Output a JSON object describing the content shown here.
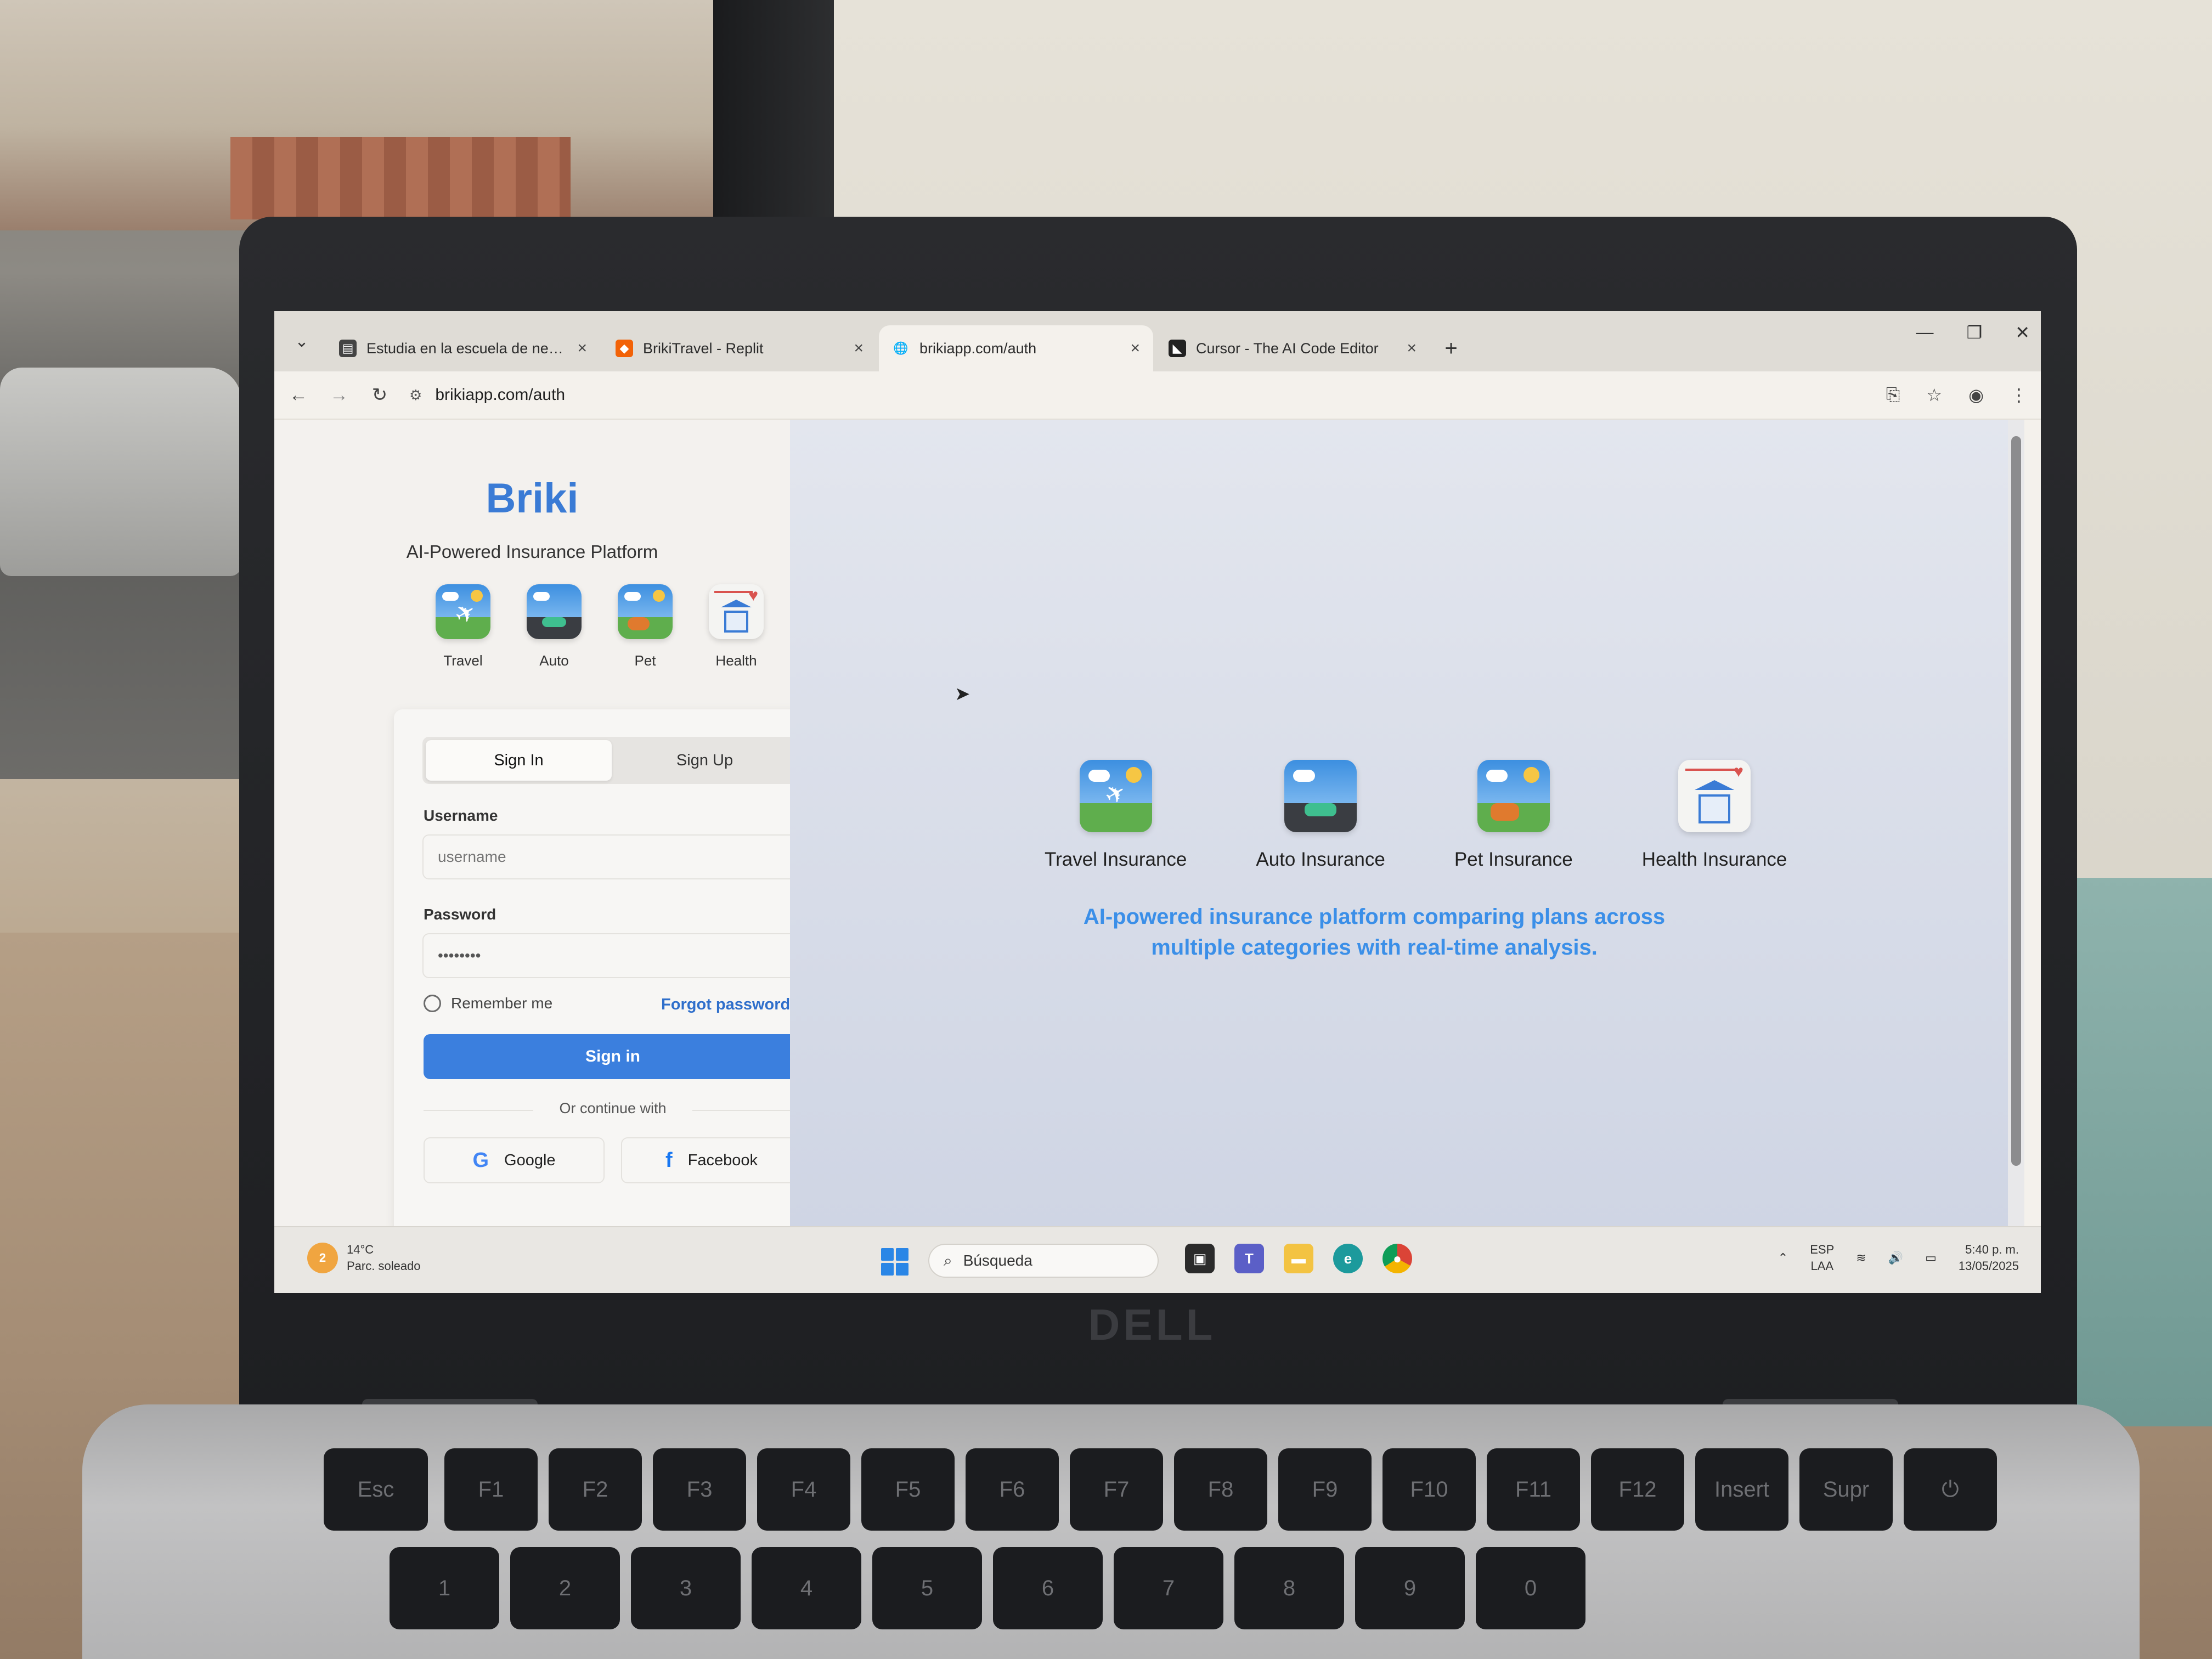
{
  "browser": {
    "tabs": [
      {
        "title": "Estudia en la escuela de negocios",
        "favicon": "page-icon"
      },
      {
        "title": "BrikiTravel - Replit",
        "favicon": "replit-icon"
      },
      {
        "title": "brikiapp.com/auth",
        "favicon": "globe-icon",
        "active": true
      },
      {
        "title": "Cursor - The AI Code Editor",
        "favicon": "cursor-icon"
      }
    ],
    "url": "brikiapp.com/auth"
  },
  "app": {
    "brand": "Briki",
    "tagline": "AI-Powered Insurance Platform",
    "mini_categories": [
      "Travel",
      "Auto",
      "Pet",
      "Health"
    ],
    "auth": {
      "tabs": [
        "Sign In",
        "Sign Up"
      ],
      "username_label": "Username",
      "username_placeholder": "username",
      "password_label": "Password",
      "password_value": "••••••••",
      "remember_label": "Remember me",
      "forgot_label": "Forgot password?",
      "submit_label": "Sign in",
      "divider_label": "Or continue with",
      "google_label": "Google",
      "facebook_label": "Facebook"
    },
    "hero": {
      "categories": [
        "Travel Insurance",
        "Auto Insurance",
        "Pet Insurance",
        "Health Insurance"
      ],
      "description": "AI-powered insurance platform comparing plans across multiple categories with real-time analysis."
    },
    "colors": {
      "accent": "#3b7fde",
      "brand": "#3a7bd5",
      "hero_text": "#3b8fe8"
    }
  },
  "taskbar": {
    "weather_alert": "2",
    "temperature": "14°C",
    "weather_desc": "Parc. soleado",
    "search_placeholder": "Búsqueda",
    "lang_top": "ESP",
    "lang_bottom": "LAA",
    "time": "5:40 p. m.",
    "date": "13/05/2025"
  },
  "keyboard": {
    "fn_row": [
      "Esc",
      "F1",
      "F2",
      "F3",
      "F4",
      "F5",
      "F6",
      "F7",
      "F8",
      "F9",
      "F10",
      "F11",
      "F12",
      "Insert",
      "Supr"
    ],
    "num_row": [
      "1",
      "2",
      "3",
      "4",
      "5",
      "6",
      "7",
      "8",
      "9",
      "0"
    ]
  }
}
